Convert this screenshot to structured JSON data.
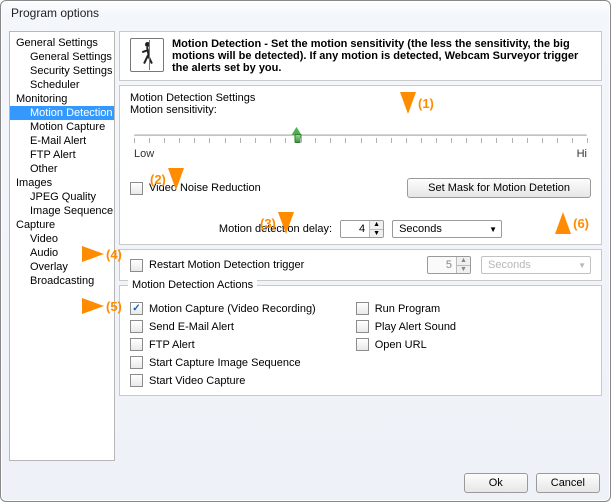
{
  "window": {
    "title": "Program options"
  },
  "tree": {
    "groups": [
      {
        "label": "General Settings",
        "children": [
          "General Settings",
          "Security Settings",
          "Scheduler"
        ]
      },
      {
        "label": "Monitoring",
        "children": [
          "Motion Detection",
          "Motion Capture",
          "E-Mail Alert",
          "FTP Alert",
          "Other"
        ],
        "active_index": 0
      },
      {
        "label": "Images",
        "children": [
          "JPEG Quality",
          "Image Sequence"
        ]
      },
      {
        "label": "Capture",
        "children": [
          "Video",
          "Audio",
          "Overlay",
          "Broadcasting"
        ]
      }
    ]
  },
  "header": {
    "bold": "Motion Detection - Set the motion sensitivity (the less the sensitivity, the big motions will be detected). If any motion is detected, Webcam Surveyor trigger the alerts set by you."
  },
  "settings": {
    "section_label": "Motion Detection Settings",
    "sensitivity_label": "Motion sensitivity:",
    "low": "Low",
    "hi": "Hi",
    "slider_percent": 36,
    "vnr_label": "Video Noise Reduction",
    "vnr_checked": false,
    "mask_button": "Set Mask for Motion Detetion",
    "delay_label": "Motion detection delay:",
    "delay_value": "4",
    "delay_unit": "Seconds"
  },
  "restart": {
    "label": "Restart Motion Detection trigger",
    "checked": false,
    "value": "5",
    "unit": "Seconds"
  },
  "actions": {
    "legend": "Motion Detection Actions",
    "left": [
      {
        "label": "Motion Capture (Video Recording)",
        "checked": true
      },
      {
        "label": "Send E-Mail  Alert",
        "checked": false
      },
      {
        "label": "FTP Alert",
        "checked": false
      },
      {
        "label": "Start Capture Image Sequence",
        "checked": false
      },
      {
        "label": "Start Video Capture",
        "checked": false
      }
    ],
    "right": [
      {
        "label": "Run Program",
        "checked": false
      },
      {
        "label": "Play Alert Sound",
        "checked": false
      },
      {
        "label": "Open URL",
        "checked": false
      }
    ]
  },
  "annotations": {
    "a1": "(1)",
    "a2": "(2)",
    "a3": "(3)",
    "a4": "(4)",
    "a5": "(5)",
    "a6": "(6)"
  },
  "footer": {
    "ok": "Ok",
    "cancel": "Cancel"
  }
}
